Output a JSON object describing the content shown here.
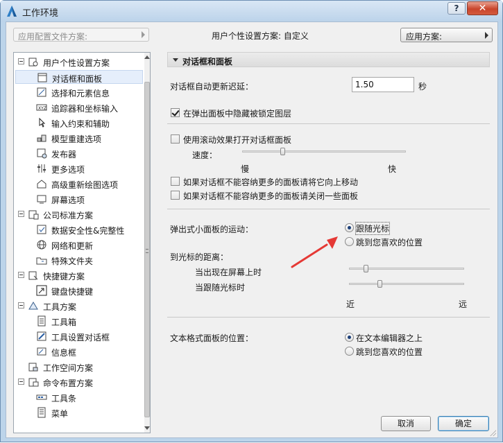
{
  "window": {
    "title": "工作环境",
    "help_label": "?",
    "close_label": "✕"
  },
  "top": {
    "profile_placeholder": "应用配置文件方案:",
    "current_scheme": "用户个性设置方案:  自定义",
    "apply_label": "应用方案:"
  },
  "tree": [
    {
      "label": "用户个性设置方案",
      "level": 0,
      "icon": "user-scheme-icon",
      "expanded": true
    },
    {
      "label": "对话框和面板",
      "level": 1,
      "icon": "dialog-panel-icon",
      "selected": true
    },
    {
      "label": "选择和元素信息",
      "level": 1,
      "icon": "selection-info-icon"
    },
    {
      "label": "追踪器和坐标输入",
      "level": 1,
      "icon": "tracker-xyz-icon"
    },
    {
      "label": "输入约束和辅助",
      "level": 1,
      "icon": "input-constraint-icon"
    },
    {
      "label": "模型重建选项",
      "level": 1,
      "icon": "model-rebuild-icon"
    },
    {
      "label": "发布器",
      "level": 1,
      "icon": "publisher-icon"
    },
    {
      "label": "更多选项",
      "level": 1,
      "icon": "more-options-icon"
    },
    {
      "label": "高级重新绘图选项",
      "level": 1,
      "icon": "redraw-icon"
    },
    {
      "label": "屏幕选项",
      "level": 1,
      "icon": "screen-icon"
    },
    {
      "label": "公司标准方案",
      "level": 0,
      "icon": "company-scheme-icon",
      "expanded": true
    },
    {
      "label": "数据安全性&完整性",
      "level": 1,
      "icon": "data-safety-icon"
    },
    {
      "label": "网络和更新",
      "level": 1,
      "icon": "globe-icon"
    },
    {
      "label": "特殊文件夹",
      "level": 1,
      "icon": "special-folder-icon"
    },
    {
      "label": "快捷键方案",
      "level": 0,
      "icon": "shortcut-scheme-icon",
      "expanded": true
    },
    {
      "label": "键盘快捷键",
      "level": 1,
      "icon": "keyboard-shortcut-icon"
    },
    {
      "label": "工具方案",
      "level": 0,
      "icon": "tool-scheme-icon",
      "expanded": true
    },
    {
      "label": "工具箱",
      "level": 1,
      "icon": "toolbox-icon"
    },
    {
      "label": "工具设置对话框",
      "level": 1,
      "icon": "tool-settings-icon"
    },
    {
      "label": "信息框",
      "level": 1,
      "icon": "info-box-icon"
    },
    {
      "label": "工作空间方案",
      "level": 0,
      "icon": "workspace-scheme-icon"
    },
    {
      "label": "命令布置方案",
      "level": 0,
      "icon": "command-layout-icon",
      "expanded": true
    },
    {
      "label": "工具条",
      "level": 1,
      "icon": "toolbar-icon"
    },
    {
      "label": "菜单",
      "level": 1,
      "icon": "menu-icon"
    }
  ],
  "panel": {
    "header": "对话框和面板",
    "delay_label": "对话框自动更新迟延：",
    "delay_value": "1.50",
    "delay_unit": "秒",
    "hide_locked_label": "在弹出面板中隐藏被锁定图层",
    "hide_locked_checked": true,
    "scroll_effect_label": "使用滚动效果打开对话框面板",
    "scroll_effect_checked": false,
    "speed_label": "速度：",
    "speed_value": 0.25,
    "speed_min": "慢",
    "speed_max": "快",
    "move_up_label": "如果对话框不能容纳更多的面板请将它向上移动",
    "move_up_checked": false,
    "close_some_label": "如果对话框不能容纳更多的面板请关闭一些面板",
    "close_some_checked": false,
    "popup_motion_label": "弹出式小面板的运动：",
    "popup_follow_label": "跟随光标",
    "popup_follow_checked": true,
    "popup_preferred_label": "跳到您喜欢的位置",
    "popup_preferred_checked": false,
    "distance_label": "到光标的距离：",
    "on_screen_label": "当出现在屏幕上时",
    "on_screen_value": 0.15,
    "follow_cursor_label": "当跟随光标时",
    "follow_cursor_value": 0.27,
    "near_label": "近",
    "far_label": "远",
    "text_panel_label": "文本格式面板的位置：",
    "above_editor_label": "在文本编辑器之上",
    "above_editor_checked": true,
    "text_preferred_label": "跳到您喜欢的位置",
    "text_preferred_checked": false
  },
  "buttons": {
    "cancel": "取消",
    "ok": "确定"
  },
  "colors": {
    "window_frame": "#bcd4ea",
    "close_button": "#c9452c",
    "annotation_arrow": "#e53935",
    "selection": "#e5eefb"
  }
}
